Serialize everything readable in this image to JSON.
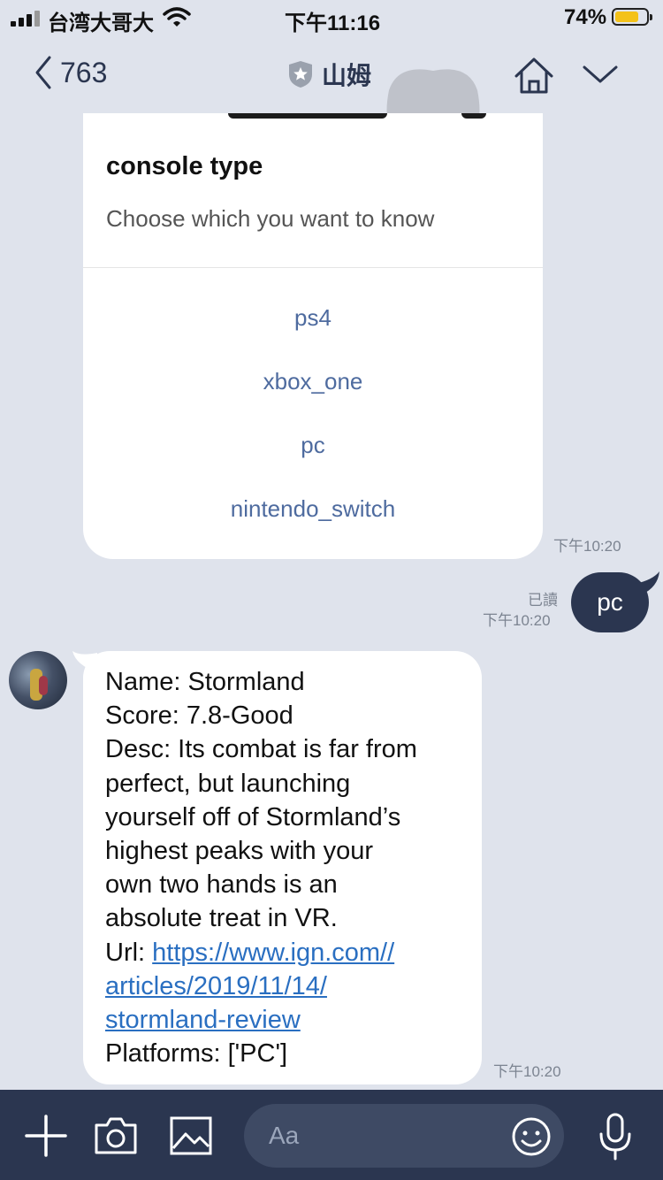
{
  "status_bar": {
    "carrier": "台湾大哥大",
    "time": "下午11:16",
    "battery_percent": "74%",
    "battery_level": 0.74,
    "battery_color": "#f4c21a"
  },
  "header": {
    "back_count": "763",
    "title": "山姆",
    "icons": [
      "chevron-left-icon",
      "shield-star-icon",
      "home-icon",
      "chevron-down-icon"
    ]
  },
  "messages": {
    "card": {
      "title": "console type",
      "subtitle": "Choose which you want to know",
      "actions": [
        "ps4",
        "xbox_one",
        "pc",
        "nintendo_switch"
      ],
      "time": "下午10:20"
    },
    "outgoing": {
      "text": "pc",
      "read": "已讀",
      "time": "下午10:20"
    },
    "incoming": {
      "lines": [
        "Name: Stormland",
        "Score: 7.8-Good",
        "Desc: Its combat is far from",
        "perfect, but launching",
        "yourself off of Stormland’s",
        "highest peaks with your",
        "own two hands is an",
        "absolute treat in VR."
      ],
      "url_label": "Url: ",
      "url_lines": [
        "https://www.ign.com//",
        "articles/2019/11/14/",
        "stormland-review"
      ],
      "platforms": "Platforms: ['PC']",
      "time": "下午10:20"
    }
  },
  "input_bar": {
    "placeholder": "Aa",
    "icons": [
      "plus-icon",
      "camera-icon",
      "image-icon",
      "emoji-icon",
      "microphone-icon"
    ]
  },
  "colors": {
    "background": "#dfe3ec",
    "navy": "#2b3650",
    "link": "#2a6fc1",
    "action": "#4e6b9f"
  }
}
